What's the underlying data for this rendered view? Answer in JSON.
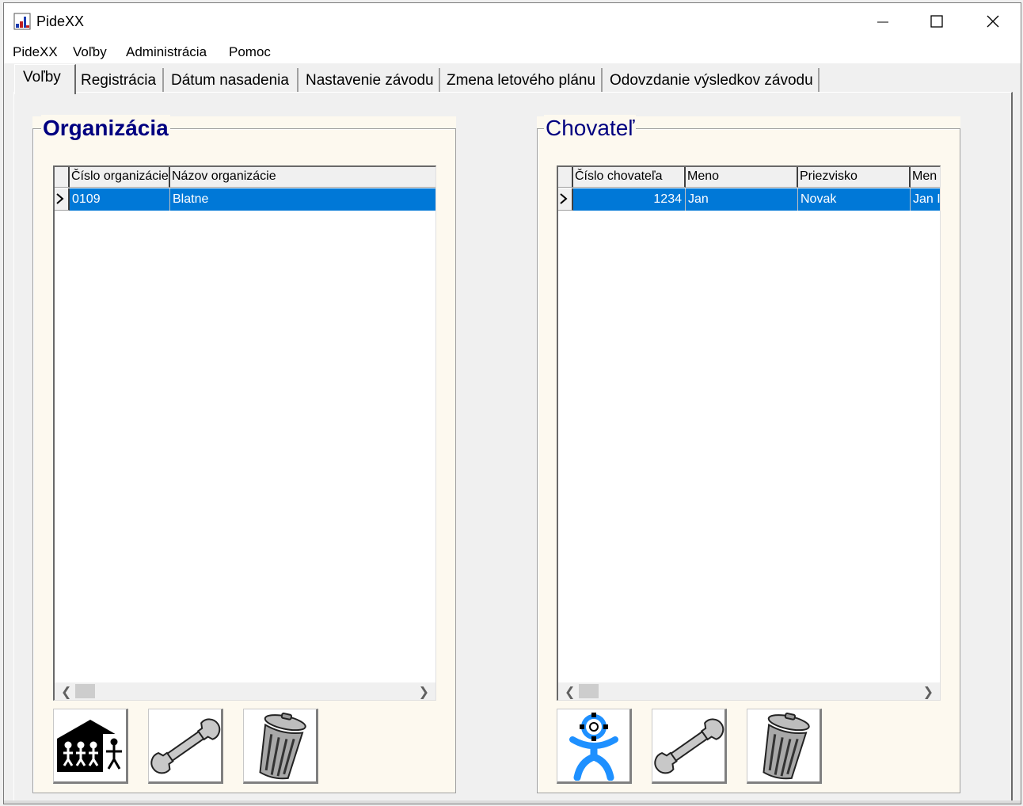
{
  "window": {
    "title": "PideXX"
  },
  "menu": [
    "PideXX",
    "Voľby",
    "Administrácia",
    "Pomoc"
  ],
  "tabs": [
    "Voľby",
    "Registrácia",
    "Dátum nasadenia",
    "Nastavenie závodu",
    "Zmena letového plánu",
    "Odovzdanie výsledkov závodu"
  ],
  "organizacia": {
    "title": "Organizácia",
    "columns": [
      "Číslo organizácie",
      "Názov organizácie"
    ],
    "rows": [
      {
        "cislo": "0109",
        "nazov": "Blatne"
      }
    ],
    "buttons": {
      "add": "organization-house-icon",
      "edit": "wrench-icon",
      "delete": "trash-can-icon"
    }
  },
  "chovatel": {
    "title": "Chovateľ",
    "columns": [
      "Číslo chovateľa",
      "Meno",
      "Priezvisko",
      "Men"
    ],
    "rows": [
      {
        "cislo": "1234",
        "meno": "Jan",
        "priezvisko": "Novak",
        "extra": "Jan I"
      }
    ],
    "buttons": {
      "add": "person-icon",
      "edit": "wrench-icon",
      "delete": "trash-can-icon"
    }
  },
  "colors": {
    "selection": "#0078d7",
    "group_title": "#000080",
    "group_bg": "#fdf9ef"
  }
}
